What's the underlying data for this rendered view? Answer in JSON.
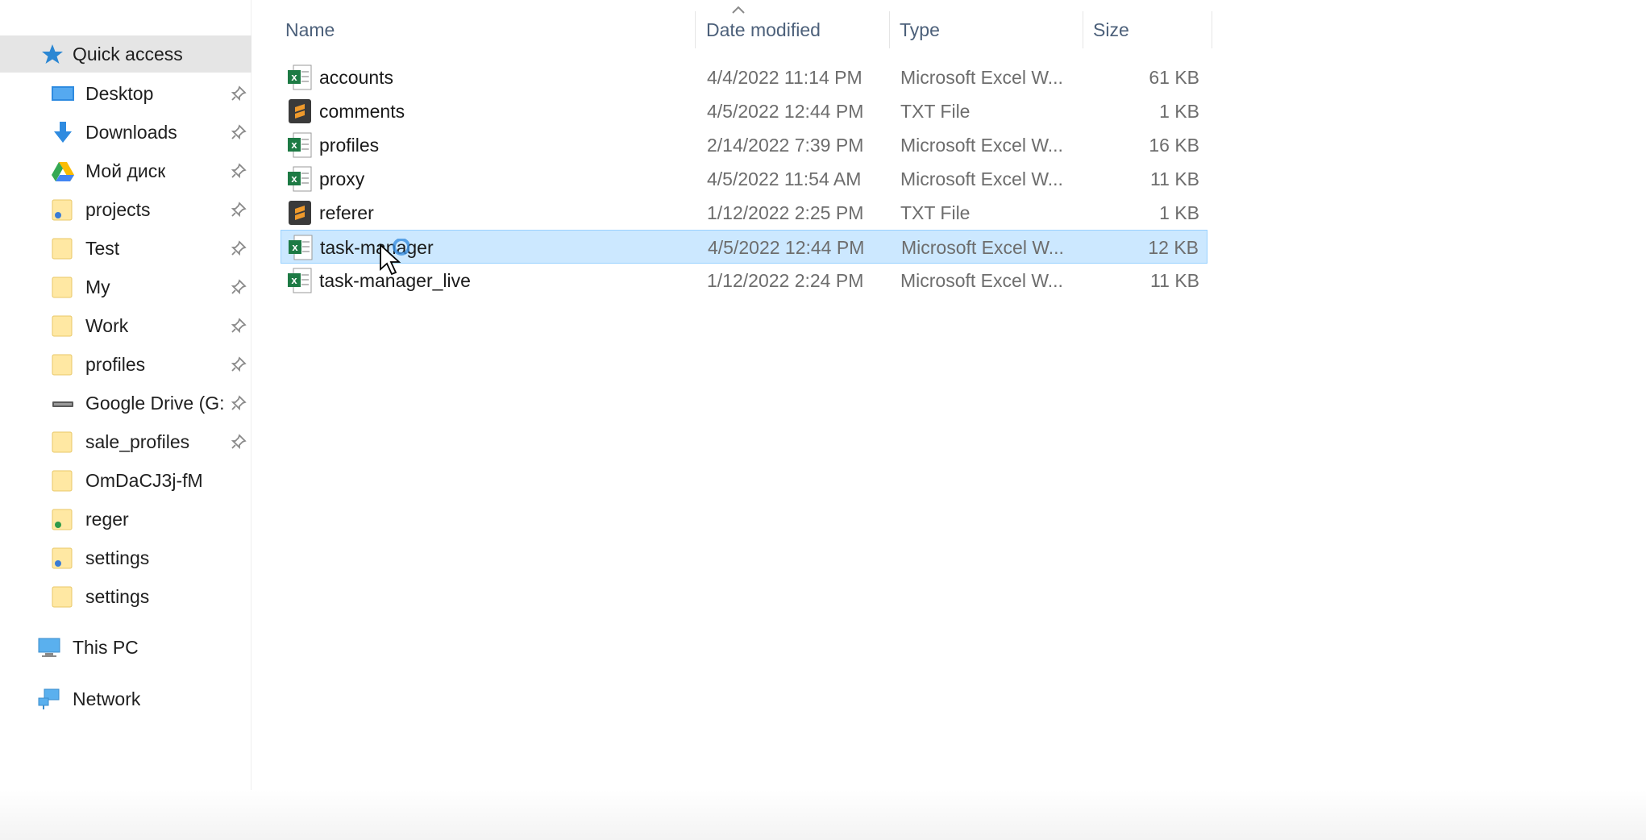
{
  "columns": {
    "name": "Name",
    "date_modified": "Date modified",
    "type": "Type",
    "size": "Size"
  },
  "sidebar": {
    "quick_access": "Quick access",
    "items": [
      {
        "label": "Desktop",
        "icon": "desktop-icon",
        "pinned": true
      },
      {
        "label": "Downloads",
        "icon": "downloads-icon",
        "pinned": true
      },
      {
        "label": "Мой диск",
        "icon": "google-drive-icon",
        "pinned": true
      },
      {
        "label": "projects",
        "icon": "folder-icon",
        "pinned": true
      },
      {
        "label": "Test",
        "icon": "folder-icon",
        "pinned": true
      },
      {
        "label": "My",
        "icon": "folder-icon",
        "pinned": true
      },
      {
        "label": "Work",
        "icon": "folder-icon",
        "pinned": true
      },
      {
        "label": "profiles",
        "icon": "folder-icon",
        "pinned": true
      },
      {
        "label": "Google Drive (G:",
        "icon": "drive-icon",
        "pinned": true
      },
      {
        "label": "sale_profiles",
        "icon": "folder-icon",
        "pinned": true
      },
      {
        "label": "OmDaCJ3j-fM",
        "icon": "folder-icon",
        "pinned": false
      },
      {
        "label": "reger",
        "icon": "folder-icon",
        "pinned": false
      },
      {
        "label": "settings",
        "icon": "folder-icon",
        "pinned": false
      },
      {
        "label": "settings",
        "icon": "folder-icon",
        "pinned": false
      }
    ],
    "this_pc": "This PC",
    "network": "Network"
  },
  "files": [
    {
      "name": "accounts",
      "date": "4/4/2022 11:14 PM",
      "type": "Microsoft Excel W...",
      "size": "61 KB",
      "icon": "excel-icon"
    },
    {
      "name": "comments",
      "date": "4/5/2022 12:44 PM",
      "type": "TXT File",
      "size": "1 KB",
      "icon": "sublime-text-icon"
    },
    {
      "name": "profiles",
      "date": "2/14/2022 7:39 PM",
      "type": "Microsoft Excel W...",
      "size": "16 KB",
      "icon": "excel-icon"
    },
    {
      "name": "proxy",
      "date": "4/5/2022 11:54 AM",
      "type": "Microsoft Excel W...",
      "size": "11 KB",
      "icon": "excel-icon"
    },
    {
      "name": "referer",
      "date": "1/12/2022 2:25 PM",
      "type": "TXT File",
      "size": "1 KB",
      "icon": "sublime-text-icon"
    },
    {
      "name": "task-manager",
      "date": "4/5/2022 12:44 PM",
      "type": "Microsoft Excel W...",
      "size": "12 KB",
      "icon": "excel-icon",
      "selected": true
    },
    {
      "name": "task-manager_live",
      "date": "1/12/2022 2:24 PM",
      "type": "Microsoft Excel W...",
      "size": "11 KB",
      "icon": "excel-icon"
    }
  ],
  "colors": {
    "selection_bg": "#cce8ff",
    "selection_border": "#99d1ff",
    "header_text": "#4c607a",
    "folder": "#ffe8a3",
    "excel_green": "#1d7a44",
    "sublime_orange": "#ef9a2c"
  }
}
